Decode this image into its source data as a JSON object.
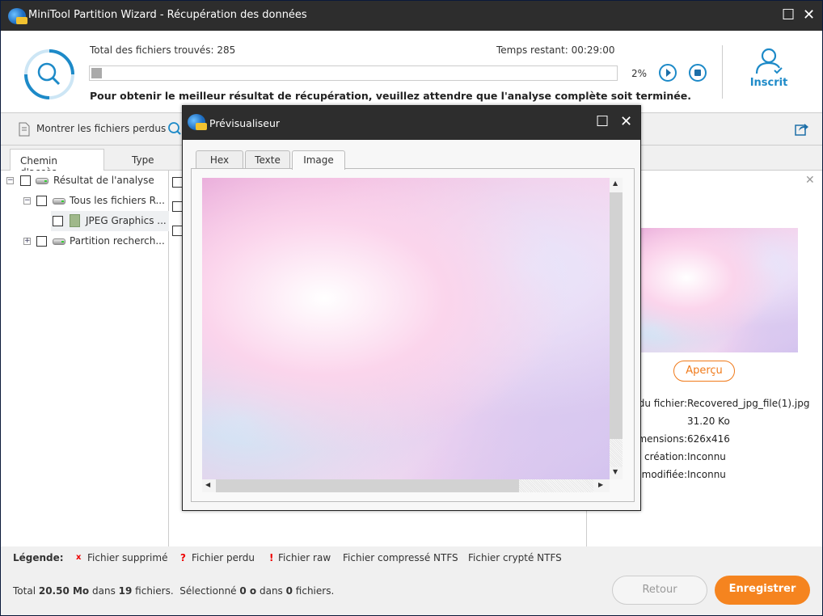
{
  "window": {
    "title": "MiniTool Partition Wizard - Récupération des données"
  },
  "scan": {
    "found_label": "Total des fichiers trouvés:",
    "found_value": "285",
    "remaining_label": "Temps restant:",
    "remaining_value": "00:29:00",
    "progress_percent": 2,
    "progress_text": "2%",
    "message": "Pour obtenir le meilleur résultat de récupération, veuillez attendre que l'analyse complète soit terminée.",
    "account_label": "Inscrit"
  },
  "toolbar": {
    "show_lost": "Montrer les fichiers perdus"
  },
  "tabs": [
    {
      "label": "Chemin d'accès",
      "active": true
    },
    {
      "label": "Type",
      "active": false
    }
  ],
  "tree": [
    {
      "label": "Résultat de l'analyse",
      "level": 0
    },
    {
      "label": "Tous les fichiers R...",
      "level": 1
    },
    {
      "label": "JPEG Graphics ...",
      "level": 2
    },
    {
      "label": "Partition recherch...",
      "level": 1
    }
  ],
  "details": {
    "preview_button": "Aperçu",
    "rows": [
      {
        "label": "Nom du fichier:",
        "value": "Recovered_jpg_file(1).jpg"
      },
      {
        "label": "",
        "value": "31.20 Ko"
      },
      {
        "label": "Dimensions:",
        "value": "626x416"
      },
      {
        "label": "Date de création:",
        "value": "Inconnu"
      },
      {
        "label": "Date modifiée:",
        "value": "Inconnu"
      }
    ]
  },
  "legend": {
    "title": "Légende:",
    "items": [
      {
        "mark": "x",
        "label": "Fichier supprimé"
      },
      {
        "mark": "?",
        "label": "Fichier perdu"
      },
      {
        "mark": "!",
        "label": "Fichier raw"
      },
      {
        "mark": "",
        "label": "Fichier compressé NTFS"
      },
      {
        "mark": "",
        "label": "Fichier crypté NTFS"
      }
    ]
  },
  "status": {
    "t1": "Total ",
    "size": "20.50 Mo",
    "t2": " dans ",
    "count": "19",
    "t3": " fichiers.  Sélectionné ",
    "sel_size": "0 o",
    "t4": " dans ",
    "sel_count": "0",
    "t5": " fichiers."
  },
  "buttons": {
    "back": "Retour",
    "save": "Enregistrer"
  },
  "dialog": {
    "title": "Prévisualiseur",
    "tabs": [
      "Hex",
      "Texte",
      "Image"
    ],
    "active_tab": "Image"
  },
  "colors": {
    "accent": "#1d8ac8",
    "orange": "#f5841f",
    "titlebar": "#2d2d2d"
  }
}
